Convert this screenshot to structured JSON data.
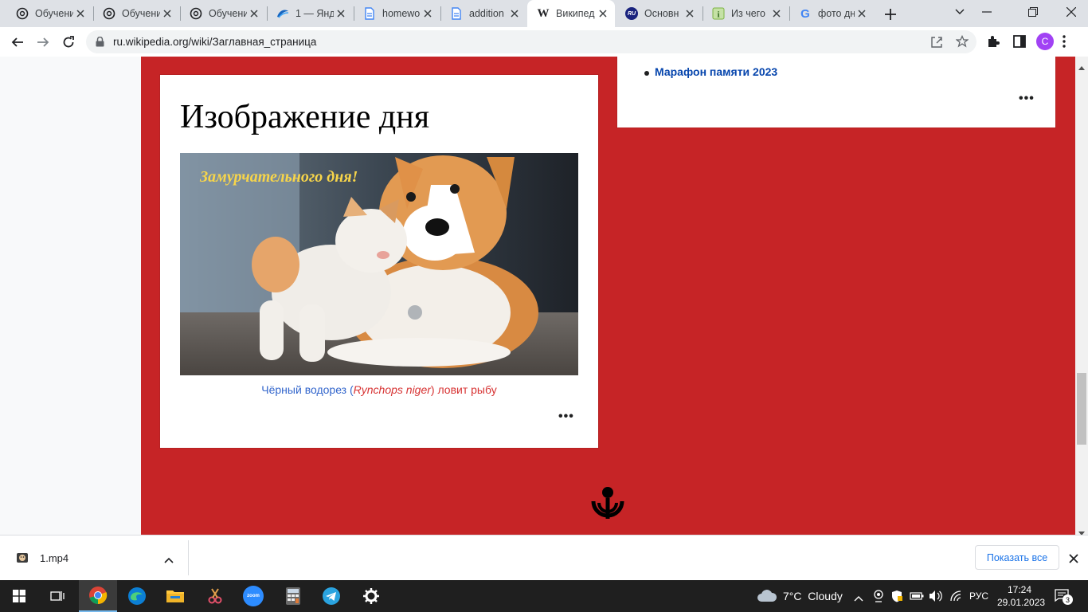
{
  "browser": {
    "tabs": [
      {
        "title": "Обучени",
        "icon": "openai-icon"
      },
      {
        "title": "Обучени",
        "icon": "openai-icon"
      },
      {
        "title": "Обучени",
        "icon": "openai-icon"
      },
      {
        "title": "1 — Янд",
        "icon": "yandex-wave-icon"
      },
      {
        "title": "homewo",
        "icon": "document-icon"
      },
      {
        "title": "addition",
        "icon": "document-icon"
      },
      {
        "title": "Википед",
        "icon": "wikipedia-icon",
        "favicon_text": "W"
      },
      {
        "title": "Основн",
        "icon": "ru-icon",
        "favicon_text": "RU"
      },
      {
        "title": "Из чего",
        "icon": "info-icon"
      },
      {
        "title": "фото дн",
        "icon": "google-icon",
        "favicon_text": "G"
      }
    ],
    "address": "ru.wikipedia.org/wiki/Заглавная_страница",
    "profile_initial": "C"
  },
  "page": {
    "featured": {
      "title": "Изображение дня",
      "image_overlay_text": "Замурчательного дня!",
      "caption_prefix": "Чёрный водорез (",
      "caption_species": "Rynchops niger",
      "caption_suffix": ") ловит рыбу",
      "more": "•••"
    },
    "right_card": {
      "list_item": "Марафон памяти 2023",
      "more": "•••"
    }
  },
  "downloads": {
    "file_name": "1.mp4",
    "show_all": "Показать все"
  },
  "taskbar": {
    "weather": "7°C  Cloudy",
    "language": "РУС",
    "time": "17:24",
    "date": "29.01.2023",
    "notifications": "3"
  },
  "colors": {
    "accent_red": "#c62426",
    "link_blue": "#3366cc",
    "bold_link": "#0645ad",
    "tab_strip": "#dee1e6",
    "taskbar": "#1f1f1f"
  }
}
